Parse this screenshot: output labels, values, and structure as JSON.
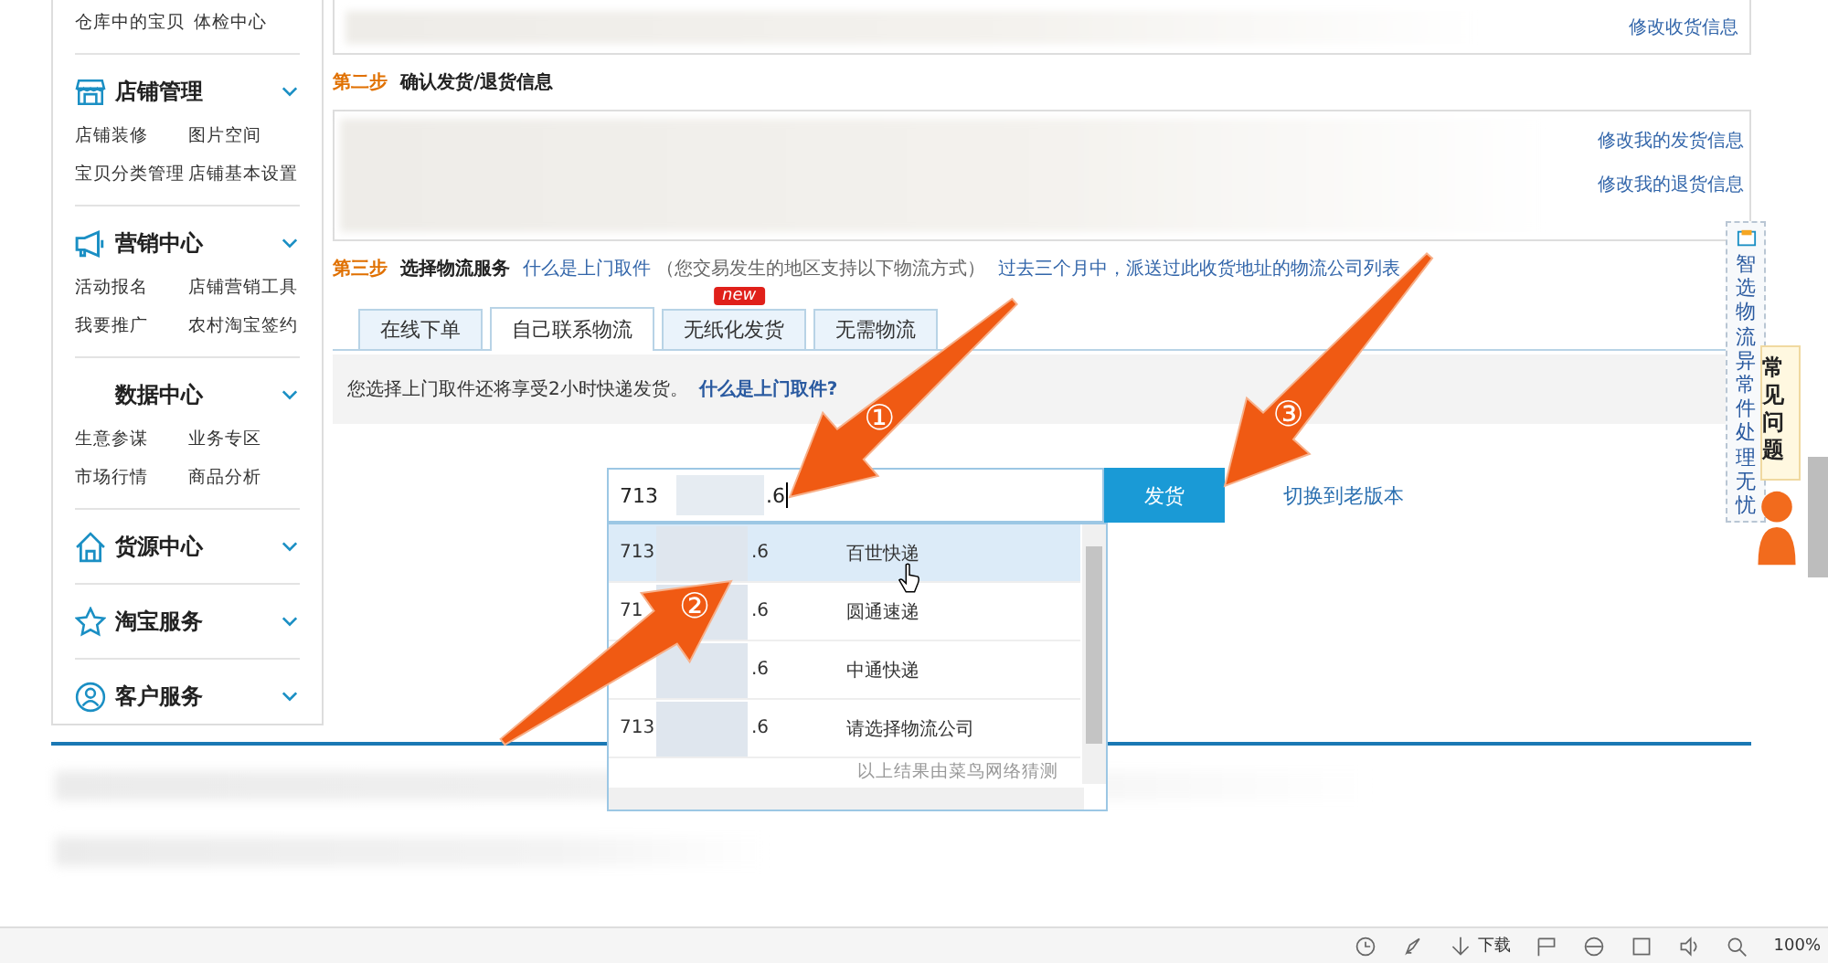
{
  "sidebar": {
    "top_links": [
      "仓库中的宝贝",
      "体检中心"
    ],
    "sections": [
      {
        "title": "店铺管理",
        "links": [
          "店铺装修",
          "图片空间",
          "宝贝分类管理",
          "店铺基本设置"
        ]
      },
      {
        "title": "营销中心",
        "links": [
          "活动报名",
          "店铺营销工具",
          "我要推广",
          "农村淘宝签约"
        ]
      },
      {
        "title": "数据中心",
        "links": [
          "生意参谋",
          "业务专区",
          "市场行情",
          "商品分析"
        ]
      },
      {
        "title": "货源中心"
      },
      {
        "title": "淘宝服务"
      },
      {
        "title": "客户服务"
      }
    ]
  },
  "address_box": {
    "link": "修改收货信息"
  },
  "step2": {
    "label": "第二步",
    "title": "确认发货/退货信息",
    "links": [
      "修改我的发货信息",
      "修改我的退货信息"
    ]
  },
  "step3": {
    "label": "第三步",
    "title": "选择物流服务",
    "link": "什么是上门取件",
    "note": "（您交易发生的地区支持以下物流方式）",
    "history_link": "过去三个月中，派送过此收货地址的物流公司列表"
  },
  "tabs": [
    {
      "label": "在线下单",
      "selected": false
    },
    {
      "label": "自己联系物流",
      "selected": true
    },
    {
      "label": "无纸化发货",
      "selected": false,
      "badge": "new"
    },
    {
      "label": "无需物流",
      "selected": false
    }
  ],
  "info": {
    "text": "您选择上门取件还将享受2小时快递发货。",
    "link": "什么是上门取件?"
  },
  "tracking": {
    "prefix": "713",
    "suffix": ".6",
    "button": "发货",
    "switch_link": "切换到老版本"
  },
  "suggestions": [
    {
      "prefix": "713",
      "suffix": ".6",
      "company": "百世快递",
      "selected": true
    },
    {
      "prefix": "71",
      "suffix": ".6",
      "company": "圆通速递",
      "selected": false
    },
    {
      "suffix": ".6",
      "company": "中通快递",
      "selected": false
    },
    {
      "prefix": "713",
      "suffix": ".6",
      "company": "请选择物流公司",
      "selected": false
    }
  ],
  "suggestion_note": "以上结果由菜鸟网络猜测",
  "side_widget": {
    "promo": "智选物流异常件处理无忧",
    "faq": "常见问题"
  },
  "annotations": [
    {
      "label": "①"
    },
    {
      "label": "②"
    },
    {
      "label": "③"
    }
  ],
  "status_bar": {
    "download": "下载",
    "zoom": "100%"
  }
}
